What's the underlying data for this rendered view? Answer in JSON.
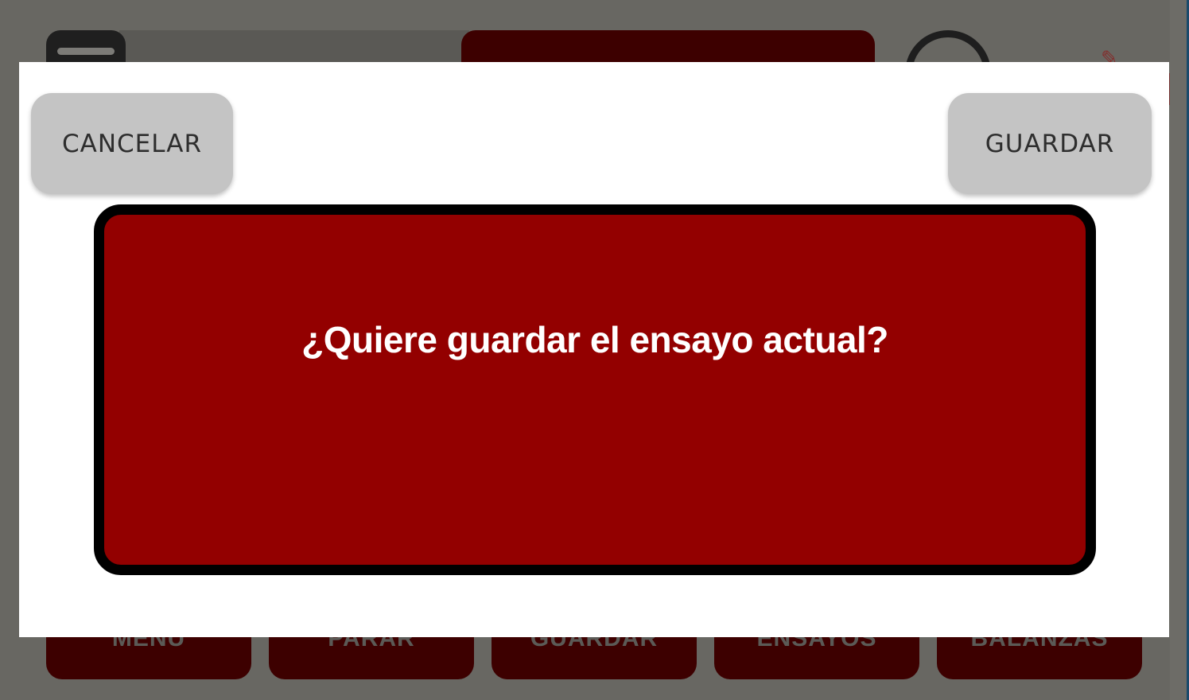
{
  "background_app": {
    "nav_buttons": [
      "MENU",
      "PARAR",
      "GUARDAR",
      "ENSAYOS",
      "BALANZAS"
    ]
  },
  "dialog": {
    "cancel_label": "CANCELAR",
    "save_label": "GUARDAR",
    "message": "¿Quiere guardar el ensayo actual?"
  },
  "colors": {
    "overlay": "#686762",
    "dialog_bg": "#ffffff",
    "button_bg": "#c4c4c4",
    "message_bg": "#930000",
    "message_border": "#000000",
    "message_text": "#ffffff"
  },
  "icons": {
    "menu_handle": "menu-icon",
    "gauge": "gauge-arc-icon",
    "edit": "edit-icon"
  }
}
